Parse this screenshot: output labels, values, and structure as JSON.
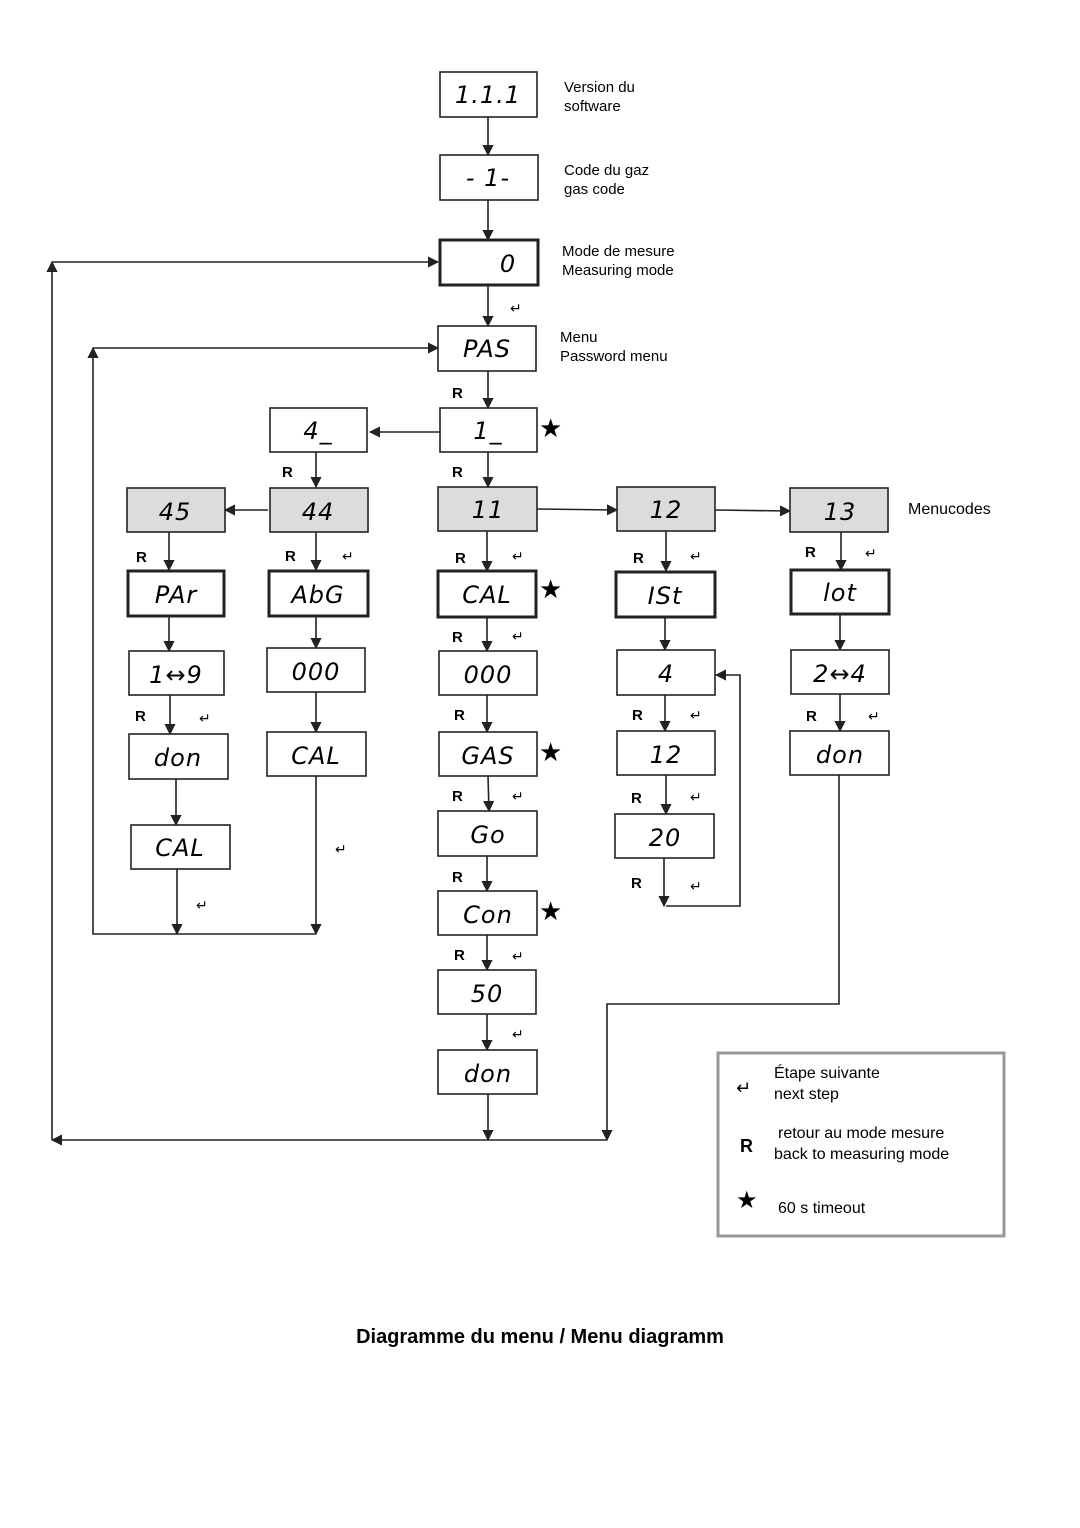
{
  "title": "Diagramme du menu / Menu diagramm",
  "colors": {
    "line": "#222222",
    "menucode_fill": "#dcdcdc",
    "legend_border": "#999999"
  },
  "annotations": {
    "version": [
      "Version du",
      "software"
    ],
    "gas_code": [
      "Code du gaz",
      "gas code"
    ],
    "measuring": [
      "Mode de mesure",
      "Measuring mode"
    ],
    "password": [
      "Menu",
      "Password menu"
    ],
    "menucodes": "Menucodes"
  },
  "symbols": {
    "r": "R",
    "enter": "↵",
    "star": "★"
  },
  "nodes": {
    "version": "1.1.1",
    "gascode": "- 1-",
    "measure": "0",
    "pas": "PAS",
    "p1": "1_",
    "p4": "4_",
    "m11": "11",
    "m12": "12",
    "m13": "13",
    "m44": "44",
    "m45": "45",
    "par": "PAr",
    "par_sel": "1↔9",
    "par_don": "don",
    "par_cal": "CAL",
    "abg": "AbG",
    "abg_val": "000",
    "abg_cal": "CAL",
    "cal": "CAL",
    "cal_zero": "000",
    "gas": "GAS",
    "go": "Go",
    "con": "Con",
    "con_val": "50",
    "cal_don": "don",
    "ist": "ISt",
    "ist_4": "4",
    "ist_12": "12",
    "ist_20": "20",
    "lot": "lot",
    "lot_sel": "2↔4",
    "lot_don": "don"
  },
  "legend": {
    "items": [
      {
        "symbol": "↵",
        "lines": [
          "Étape suivante",
          "next step"
        ]
      },
      {
        "symbol": "R",
        "lines": [
          "retour au mode mesure",
          "back to measuring mode"
        ]
      },
      {
        "symbol": "★",
        "lines": [
          "60 s timeout"
        ]
      }
    ]
  }
}
